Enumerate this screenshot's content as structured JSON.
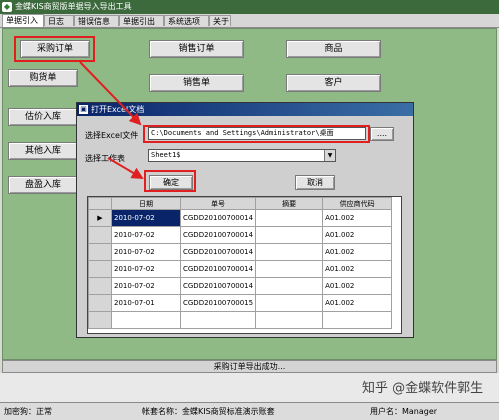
{
  "window": {
    "title": "金蝶KIS商贸版单据导入导出工具"
  },
  "tabs": [
    "单据引入",
    "日志",
    "错误信息",
    "单据引出",
    "系统选项",
    "关于"
  ],
  "buttons": {
    "purchase_order": "采购订单",
    "sales_order": "销售订单",
    "product": "商品",
    "purchase_receipt": "购货单",
    "sales_invoice": "销售单",
    "customer": "客户",
    "estimate_in": "估价入库",
    "other_in": "其他入库",
    "surplus_in": "盘盈入库"
  },
  "dialog": {
    "title": "打开Excel文档",
    "file_label": "选择Excel文件",
    "file_path": "C:\\Documents and Settings\\Administrator\\桌面",
    "browse_label": "....",
    "sheet_label": "选择工作表",
    "sheet_value": "Sheet1$",
    "ok_label": "确定",
    "cancel_label": "取消",
    "grid": {
      "columns": [
        "日期",
        "单号",
        "摘要",
        "供应商代码"
      ],
      "rows": [
        [
          "2010-07-02",
          "CGDD20100700014",
          "",
          "A01.002"
        ],
        [
          "2010-07-02",
          "CGDD20100700014",
          "",
          "A01.002"
        ],
        [
          "2010-07-02",
          "CGDD20100700014",
          "",
          "A01.002"
        ],
        [
          "2010-07-02",
          "CGDD20100700014",
          "",
          "A01.002"
        ],
        [
          "2010-07-02",
          "CGDD20100700014",
          "",
          "A01.002"
        ],
        [
          "2010-07-01",
          "CGDD20100700015",
          "",
          "A01.002"
        ]
      ]
    }
  },
  "status": {
    "message": "采购订单导出成功..."
  },
  "footer": {
    "encryption": "加密狗：正常",
    "account": "帐套名称：金蝶KIS商贸标准演示账套",
    "user": "用户名：Manager"
  },
  "watermark": "知乎 @金蝶软件郭生",
  "colors": {
    "panel_green": "#8fba86",
    "highlight_red": "#e02020",
    "dialog_title_blue": "#0a246a"
  }
}
